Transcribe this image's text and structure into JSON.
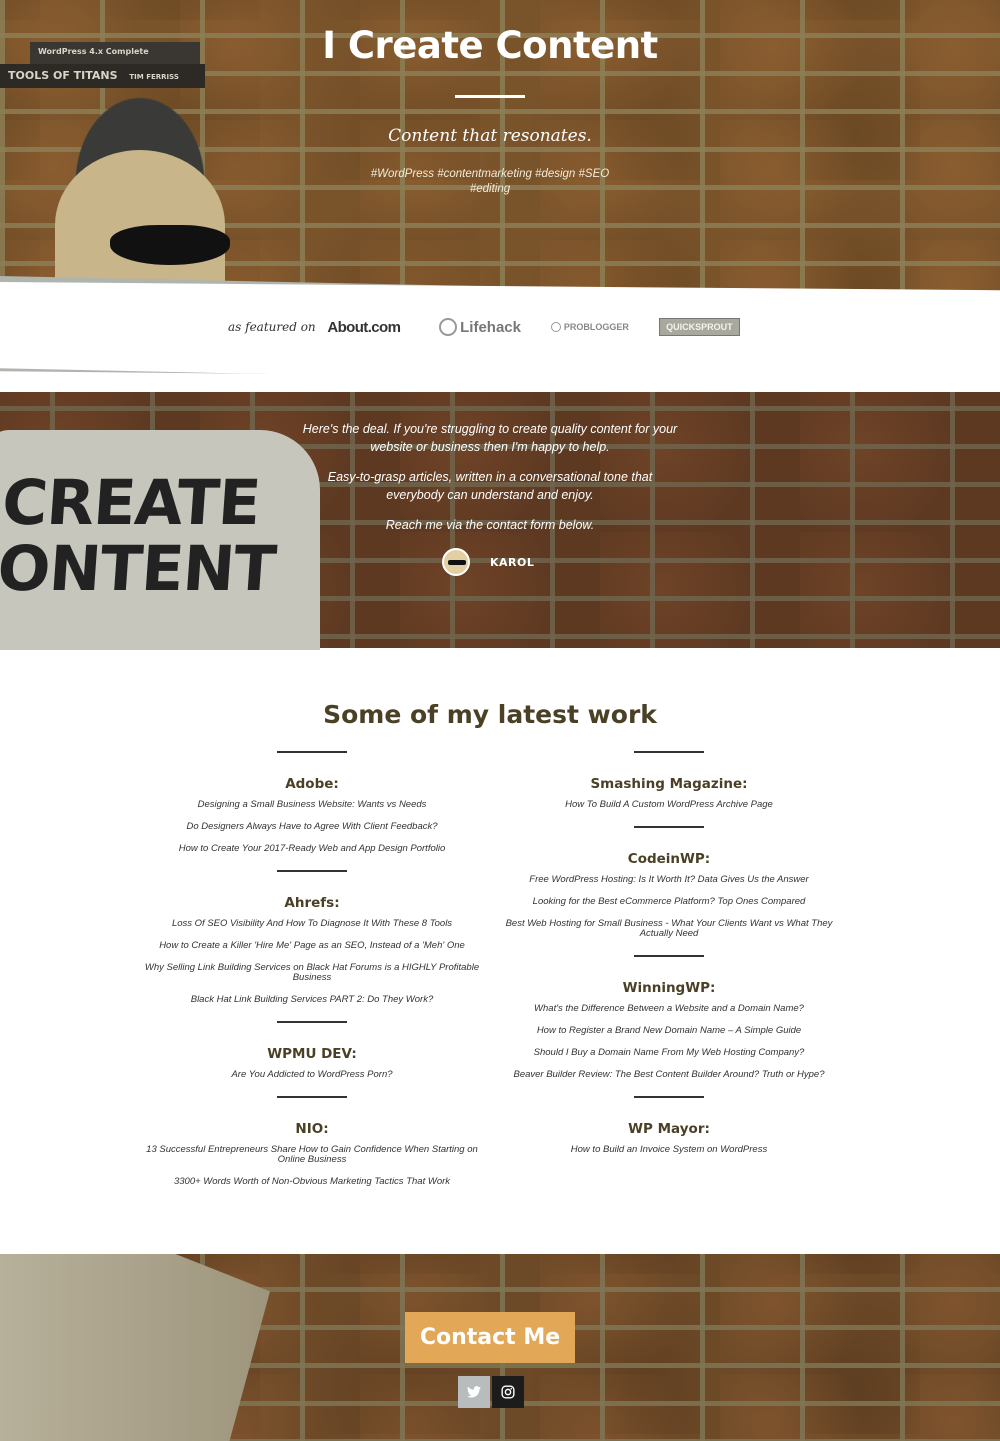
{
  "hero": {
    "title": "I Create Content",
    "tagline": "Content that resonates.",
    "tags": "#WordPress #contentmarketing #design #SEO #editing"
  },
  "featured": {
    "label": "as featured on",
    "logos": [
      "About.com",
      "Lifehack",
      "PROBLOGGER",
      "QUICKSPROUT"
    ]
  },
  "intro": {
    "paragraphs": [
      "Here's the deal. If you're struggling to create quality content for your website or business then I'm happy to help.",
      "Easy-to-grasp articles, written in a conversational tone that everybody can understand and enjoy.",
      "Reach me via the contact form below."
    ],
    "author": "KAROL",
    "tshirt_line1": "CREATE",
    "tshirt_line2": "ONTENT"
  },
  "work": {
    "title": "Some of my latest work",
    "left": [
      {
        "name": "Adobe:",
        "links": [
          "Designing a Small Business Website: Wants vs Needs",
          "Do Designers Always Have to Agree With Client Feedback?",
          "How to Create Your 2017-Ready Web and App Design Portfolio"
        ]
      },
      {
        "name": "Ahrefs:",
        "links": [
          "Loss Of SEO Visibility And How To Diagnose It With These 8 Tools",
          "How to Create a Killer 'Hire Me' Page as an SEO, Instead of a 'Meh' One",
          "Why Selling Link Building Services on Black Hat Forums is a HIGHLY Profitable Business",
          "Black Hat Link Building Services PART 2: Do They Work?"
        ]
      },
      {
        "name": "WPMU DEV:",
        "links": [
          "Are You Addicted to WordPress Porn?"
        ]
      },
      {
        "name": "NIO:",
        "links": [
          "13 Successful Entrepreneurs Share How to Gain Confidence When Starting on Online Business",
          "3300+ Words Worth of Non-Obvious Marketing Tactics That Work"
        ]
      }
    ],
    "right": [
      {
        "name": "Smashing Magazine:",
        "links": [
          "How To Build A Custom WordPress Archive Page"
        ]
      },
      {
        "name": "CodeinWP:",
        "links": [
          "Free WordPress Hosting: Is It Worth It? Data Gives Us the Answer",
          "Looking for the Best eCommerce Platform? Top Ones Compared",
          "Best Web Hosting for Small Business - What Your Clients Want vs What They Actually Need"
        ]
      },
      {
        "name": "WinningWP:",
        "links": [
          "What's the Difference Between a Website and a Domain Name?",
          "How to Register a Brand New Domain Name – A Simple Guide",
          "Should I Buy a Domain Name From My Web Hosting Company?",
          "Beaver Builder Review: The Best Content Builder Around? Truth or Hype?"
        ]
      },
      {
        "name": "WP Mayor:",
        "links": [
          "How to Build an Invoice System on WordPress"
        ]
      }
    ]
  },
  "footer": {
    "contact_label": "Contact Me",
    "book_1": "TOOLS OF TITANS",
    "book_1_author": "TIM FERRISS",
    "book_2": "WordPress 4.x Complete"
  },
  "colors": {
    "accent_button": "#e2a858",
    "heading": "#4a4026",
    "twitter_bg": "#b9bcbc",
    "instagram_bg": "#1c1c1c"
  },
  "icons": [
    "twitter-icon",
    "instagram-icon"
  ]
}
